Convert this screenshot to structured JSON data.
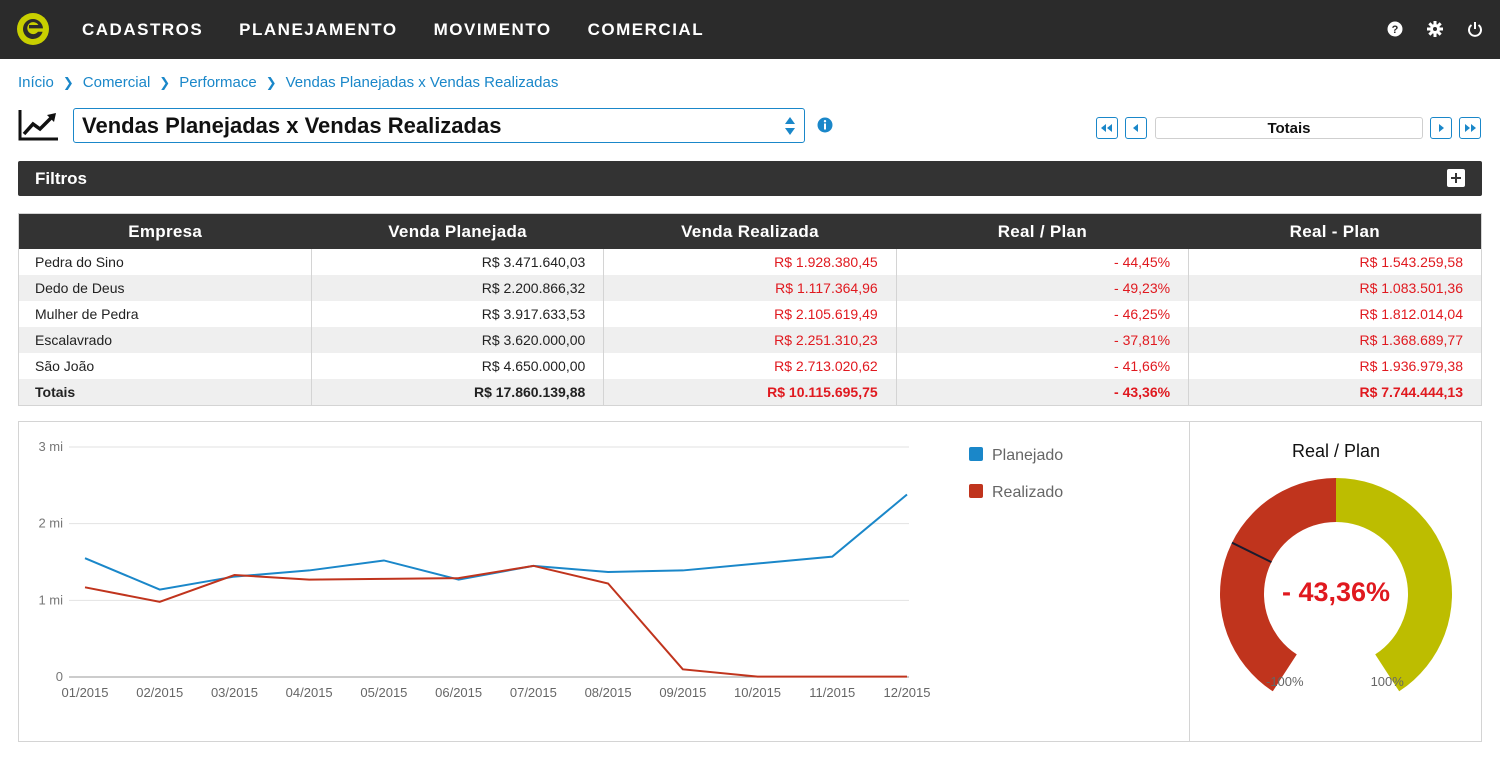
{
  "nav": {
    "items": [
      "CADASTROS",
      "PLANEJAMENTO",
      "MOVIMENTO",
      "COMERCIAL"
    ]
  },
  "breadcrumb": [
    "Início",
    "Comercial",
    "Performace",
    "Vendas Planejadas x Vendas Realizadas"
  ],
  "report": {
    "title": "Vendas Planejadas x Vendas Realizadas"
  },
  "pager": {
    "label": "Totais"
  },
  "filters": {
    "label": "Filtros"
  },
  "table": {
    "headers": [
      "Empresa",
      "Venda Planejada",
      "Venda Realizada",
      "Real / Plan",
      "Real - Plan"
    ],
    "rows": [
      [
        "Pedra do Sino",
        "R$ 3.471.640,03",
        "R$ 1.928.380,45",
        "- 44,45%",
        "R$ 1.543.259,58"
      ],
      [
        "Dedo de Deus",
        "R$ 2.200.866,32",
        "R$ 1.117.364,96",
        "- 49,23%",
        "R$ 1.083.501,36"
      ],
      [
        "Mulher de Pedra",
        "R$ 3.917.633,53",
        "R$ 2.105.619,49",
        "- 46,25%",
        "R$ 1.812.014,04"
      ],
      [
        "Escalavrado",
        "R$ 3.620.000,00",
        "R$ 2.251.310,23",
        "- 37,81%",
        "R$ 1.368.689,77"
      ],
      [
        "São João",
        "R$ 4.650.000,00",
        "R$ 2.713.020,62",
        "- 41,66%",
        "R$ 1.936.979,38"
      ]
    ],
    "totals": [
      "Totais",
      "R$ 17.860.139,88",
      "R$ 10.115.695,75",
      "- 43,36%",
      "R$ 7.744.444,13"
    ]
  },
  "chart_data": [
    {
      "type": "line",
      "categories": [
        "01/2015",
        "02/2015",
        "03/2015",
        "04/2015",
        "05/2015",
        "06/2015",
        "07/2015",
        "08/2015",
        "09/2015",
        "10/2015",
        "11/2015",
        "12/2015"
      ],
      "yticks": [
        "0",
        "1 mi",
        "2 mi",
        "3 mi"
      ],
      "ylim": [
        0,
        3000000
      ],
      "grid": true,
      "legend": "right",
      "series": [
        {
          "name": "Planejado",
          "color": "#1a87c9",
          "values": [
            1550000,
            1140000,
            1310000,
            1390000,
            1520000,
            1270000,
            1450000,
            1370000,
            1390000,
            1480000,
            1570000,
            2380000
          ]
        },
        {
          "name": "Realizado",
          "color": "#c0341d",
          "values": [
            1170000,
            980000,
            1330000,
            1270000,
            1280000,
            1290000,
            1450000,
            1220000,
            100000,
            5000,
            5000,
            5000
          ]
        }
      ]
    },
    {
      "type": "gauge",
      "title": "Real / Plan",
      "value": -43.36,
      "value_label": "- 43,36%",
      "min_label": "-100%",
      "max_label": "100%",
      "range": [
        -100,
        100
      ],
      "colors": {
        "negative": "#c0341d",
        "positive": "#bdbd00",
        "needle": "#1b1b2e",
        "value_text": "#e0191f"
      }
    }
  ],
  "colors": {
    "accent": "#1a87c9",
    "topbar": "#2b2b2b",
    "negative_text": "#e0191f",
    "logo": "#c8cf00"
  }
}
